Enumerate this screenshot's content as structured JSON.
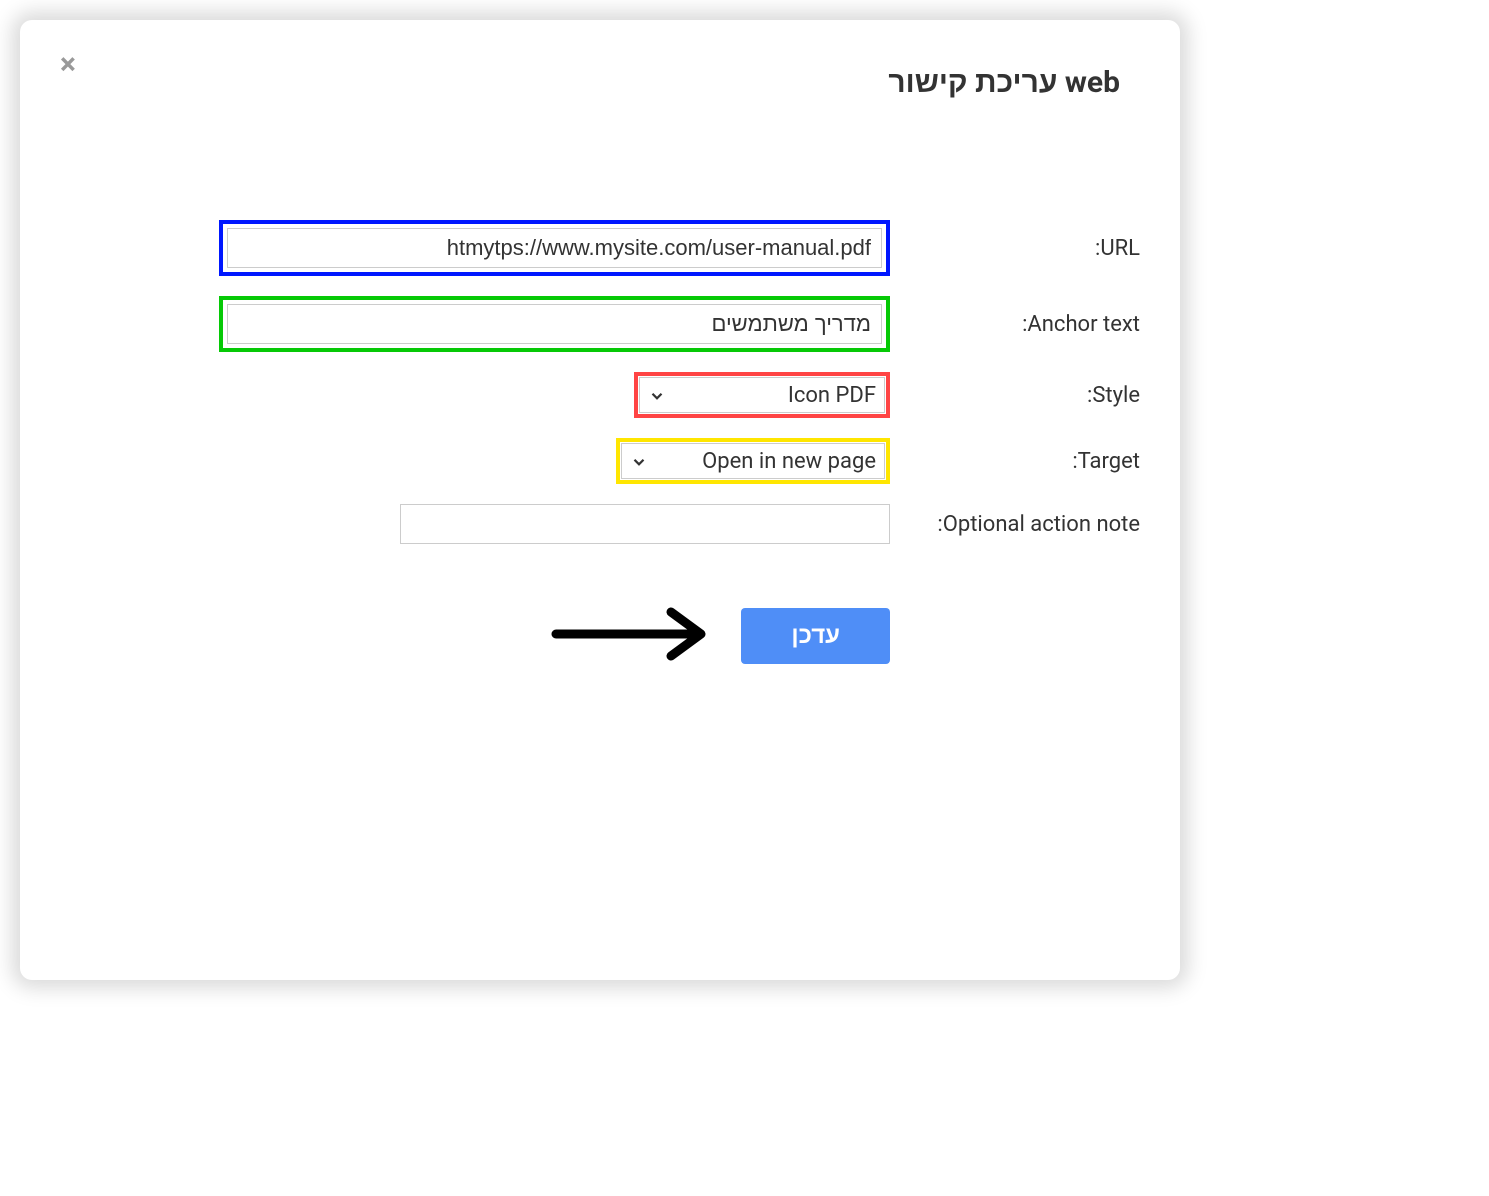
{
  "modal": {
    "title": "עריכת קישור web",
    "close_icon": "×"
  },
  "fields": {
    "url": {
      "label": "URL:",
      "value": "htmytps://www.mysite.com/user-manual.pdf"
    },
    "anchor": {
      "label": "Anchor text:",
      "value": "מדריך משתמשים"
    },
    "style": {
      "label": "Style:",
      "value": "Icon PDF"
    },
    "target": {
      "label": "Target:",
      "value": "Open in new page"
    },
    "note": {
      "label": "Optional action note:",
      "value": ""
    }
  },
  "buttons": {
    "submit": "עדכן"
  },
  "highlights": {
    "url": "#0017ff",
    "anchor": "#06c906",
    "style": "#f44",
    "target": "#ffe600"
  }
}
